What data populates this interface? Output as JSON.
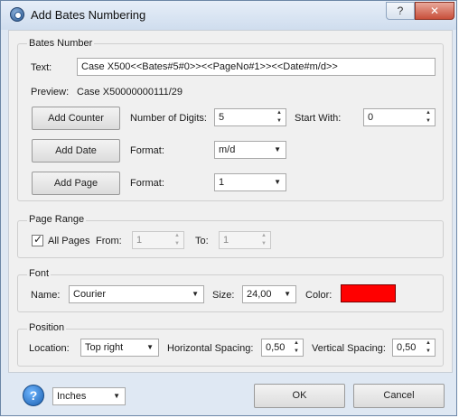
{
  "window": {
    "title": "Add Bates Numbering",
    "help_button": "?",
    "close_button": "✕"
  },
  "bates_number": {
    "legend": "Bates Number",
    "text_label": "Text:",
    "text_value": "Case X500<<Bates#5#0>><<PageNo#1>><<Date#m/d>>",
    "preview_label": "Preview:",
    "preview_value": "Case X50000000111/29",
    "add_counter_label": "Add Counter",
    "digits_label": "Number of Digits:",
    "digits_value": "5",
    "start_with_label": "Start With:",
    "start_with_value": "0",
    "add_date_label": "Add Date",
    "date_format_label": "Format:",
    "date_format_value": "m/d",
    "add_page_label": "Add Page",
    "page_format_label": "Format:",
    "page_format_value": "1"
  },
  "page_range": {
    "legend": "Page Range",
    "all_pages_label": "All Pages",
    "all_pages_checked": true,
    "from_label": "From:",
    "from_value": "1",
    "to_label": "To:",
    "to_value": "1"
  },
  "font": {
    "legend": "Font",
    "name_label": "Name:",
    "name_value": "Courier",
    "size_label": "Size:",
    "size_value": "24,00",
    "color_label": "Color:",
    "color_value": "#ff0000"
  },
  "position": {
    "legend": "Position",
    "location_label": "Location:",
    "location_value": "Top right",
    "hspacing_label": "Horizontal Spacing:",
    "hspacing_value": "0,50",
    "vspacing_label": "Vertical Spacing:",
    "vspacing_value": "0,50"
  },
  "footer": {
    "help_icon": "?",
    "units_value": "Inches",
    "ok_label": "OK",
    "cancel_label": "Cancel"
  },
  "icons": {
    "spin_up": "▲",
    "spin_down": "▼",
    "combo": "▼"
  }
}
